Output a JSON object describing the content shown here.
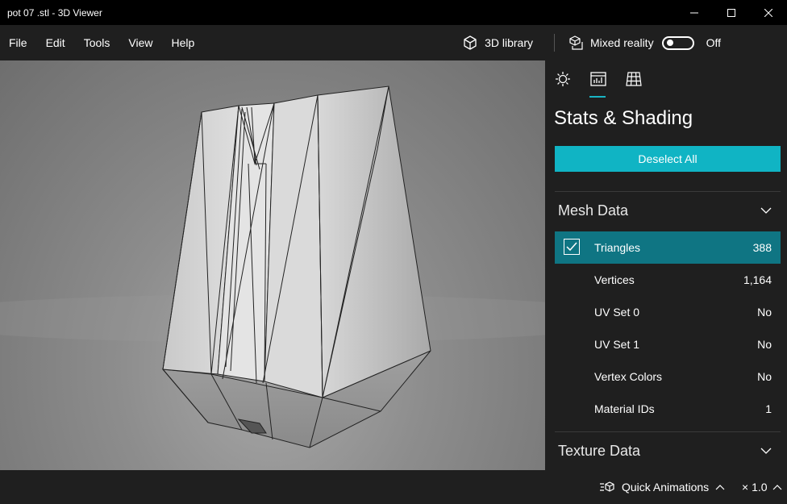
{
  "window": {
    "title": "pot 07 .stl - 3D Viewer",
    "controls": [
      "minimize",
      "maximize",
      "close"
    ]
  },
  "menu": {
    "items": [
      "File",
      "Edit",
      "Tools",
      "View",
      "Help"
    ],
    "library_label": "3D library",
    "mixed_reality_label": "Mixed reality",
    "mixed_reality_toggle": {
      "checked": false,
      "state_label": "Off"
    }
  },
  "panel": {
    "tabs": [
      {
        "name": "lighting",
        "icon": "sun-icon",
        "active": false
      },
      {
        "name": "stats",
        "icon": "stats-icon",
        "active": true
      },
      {
        "name": "grid",
        "icon": "grid-icon",
        "active": false
      }
    ],
    "title": "Stats & Shading",
    "deselect_label": "Deselect All",
    "mesh_section": {
      "label": "Mesh Data",
      "rows": [
        {
          "label": "Triangles",
          "value": "388",
          "checked": true
        },
        {
          "label": "Vertices",
          "value": "1,164"
        },
        {
          "label": "UV Set 0",
          "value": "No"
        },
        {
          "label": "UV Set 1",
          "value": "No"
        },
        {
          "label": "Vertex Colors",
          "value": "No"
        },
        {
          "label": "Material IDs",
          "value": "1"
        }
      ]
    },
    "texture_section": {
      "label": "Texture Data"
    }
  },
  "status": {
    "quick_animations_label": "Quick Animations",
    "speed_label": "× 1.0"
  },
  "colors": {
    "accent": "#10b4c4",
    "selected_row": "#0f7583",
    "background": "#1f1f1f",
    "titlebar": "#000000"
  }
}
